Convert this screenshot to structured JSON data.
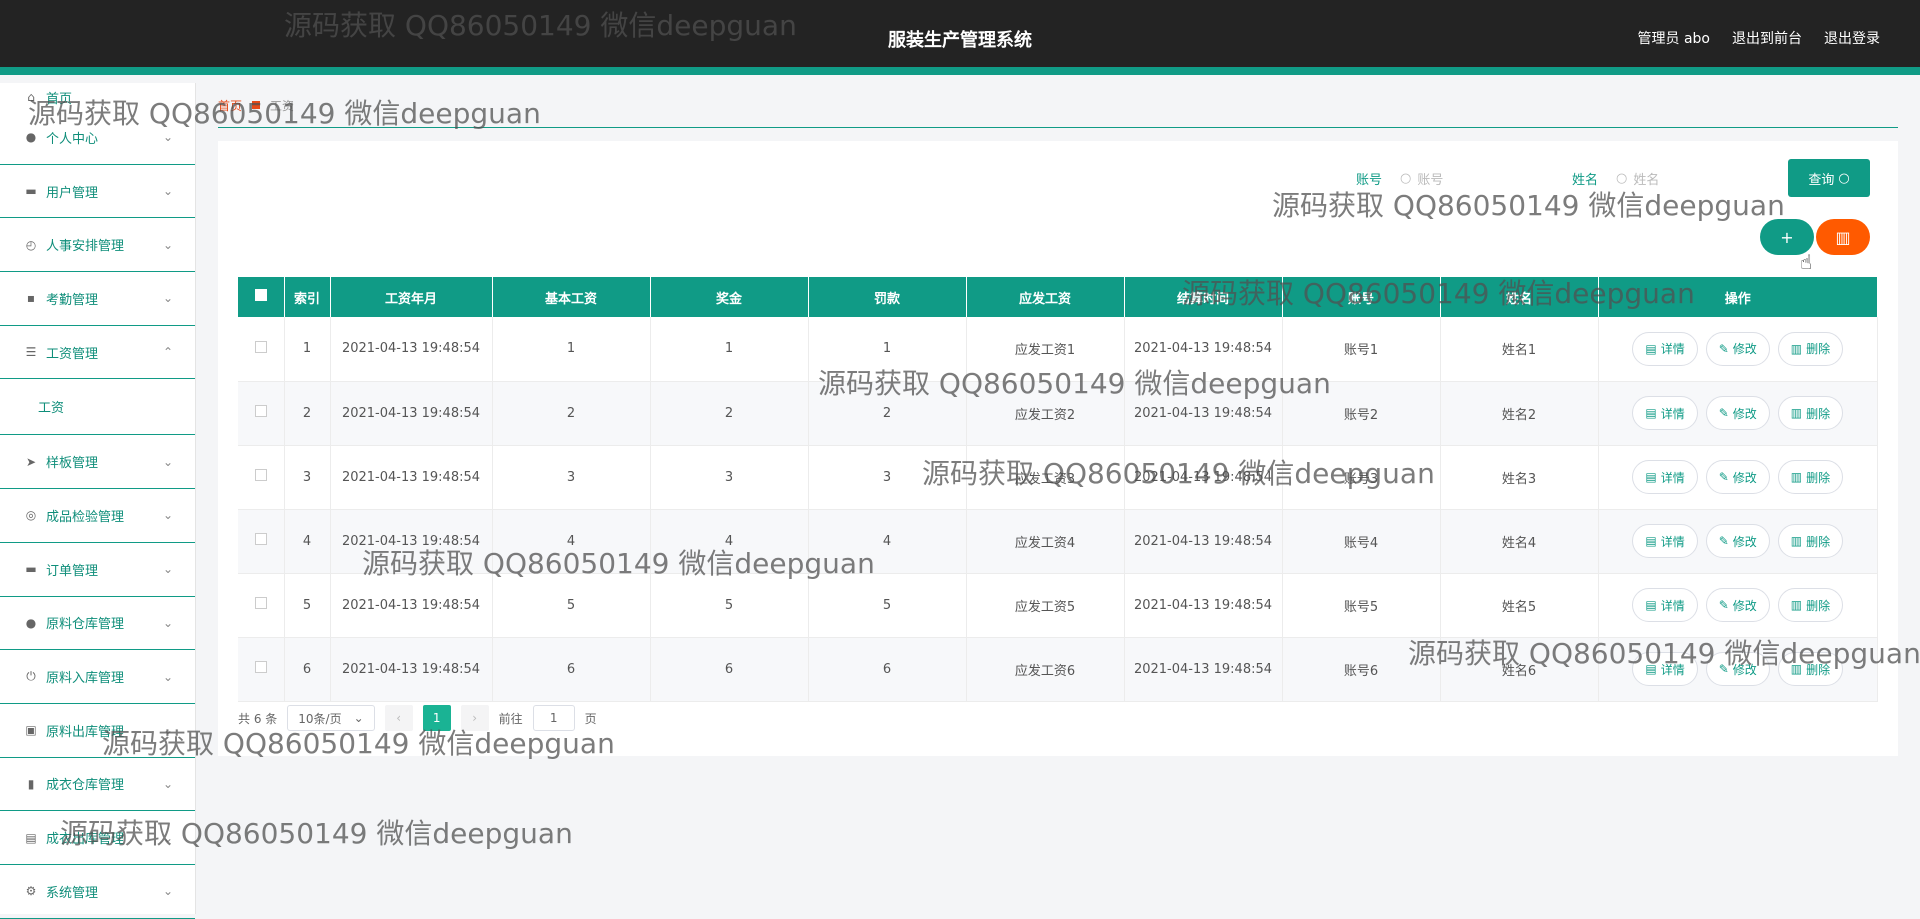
{
  "header": {
    "title": "服装生产管理系统",
    "admin": "管理员 abo",
    "to_front": "退出到前台",
    "logout": "退出登录"
  },
  "sidebar": {
    "items": [
      {
        "label": "首页",
        "icon": "home-icon"
      },
      {
        "label": "个人中心",
        "icon": "user-icon"
      },
      {
        "label": "用户管理",
        "icon": "monitor-icon"
      },
      {
        "label": "人事安排管理",
        "icon": "speedometer-icon"
      },
      {
        "label": "考勤管理",
        "icon": "chat-icon"
      },
      {
        "label": "工资管理",
        "icon": "list-icon"
      },
      {
        "label": "工资",
        "icon": ""
      },
      {
        "label": "样板管理",
        "icon": "send-icon"
      },
      {
        "label": "成品检验管理",
        "icon": "target-icon"
      },
      {
        "label": "订单管理",
        "icon": "device-icon"
      },
      {
        "label": "原料仓库管理",
        "icon": "user-icon"
      },
      {
        "label": "原料入库管理",
        "icon": "power-icon"
      },
      {
        "label": "原料出库管理",
        "icon": "box-icon"
      },
      {
        "label": "成衣仓库管理",
        "icon": "bar-chart-icon"
      },
      {
        "label": "成衣出库管理",
        "icon": "clipboard-icon"
      },
      {
        "label": "系统管理",
        "icon": "settings-icon"
      }
    ]
  },
  "breadcrumb": {
    "home": "首页",
    "current": "工资"
  },
  "search": {
    "account_label": "账号",
    "account_placeholder": "账号",
    "name_label": "姓名",
    "name_placeholder": "姓名",
    "query_button": "查询"
  },
  "table": {
    "headers": [
      "索引",
      "工资年月",
      "基本工资",
      "奖金",
      "罚款",
      "应发工资",
      "结算时间",
      "账号",
      "姓名",
      "操作"
    ],
    "rows": [
      [
        "1",
        "2021-04-13 19:48:54",
        "1",
        "1",
        "1",
        "应发工资1",
        "2021-04-13 19:48:54",
        "账号1",
        "姓名1"
      ],
      [
        "2",
        "2021-04-13 19:48:54",
        "2",
        "2",
        "2",
        "应发工资2",
        "2021-04-13 19:48:54",
        "账号2",
        "姓名2"
      ],
      [
        "3",
        "2021-04-13 19:48:54",
        "3",
        "3",
        "3",
        "应发工资3",
        "2021-04-13 19:48:54",
        "账号3",
        "姓名3"
      ],
      [
        "4",
        "2021-04-13 19:48:54",
        "4",
        "4",
        "4",
        "应发工资4",
        "2021-04-13 19:48:54",
        "账号4",
        "姓名4"
      ],
      [
        "5",
        "2021-04-13 19:48:54",
        "5",
        "5",
        "5",
        "应发工资5",
        "2021-04-13 19:48:54",
        "账号5",
        "姓名5"
      ],
      [
        "6",
        "2021-04-13 19:48:54",
        "6",
        "6",
        "6",
        "应发工资6",
        "2021-04-13 19:48:54",
        "账号6",
        "姓名6"
      ]
    ],
    "ops": {
      "detail": "详情",
      "edit": "修改",
      "delete": "删除"
    }
  },
  "pager": {
    "total": "共 6 条",
    "page_size": "10条/页",
    "current": "1",
    "goto_prefix": "前往",
    "goto_value": "1",
    "goto_suffix": "页"
  },
  "watermark": "源码获取 QQ86050149 微信deepguan",
  "colors": {
    "accent": "#109b86",
    "danger": "#ff5a00",
    "topbar": "#232323"
  }
}
